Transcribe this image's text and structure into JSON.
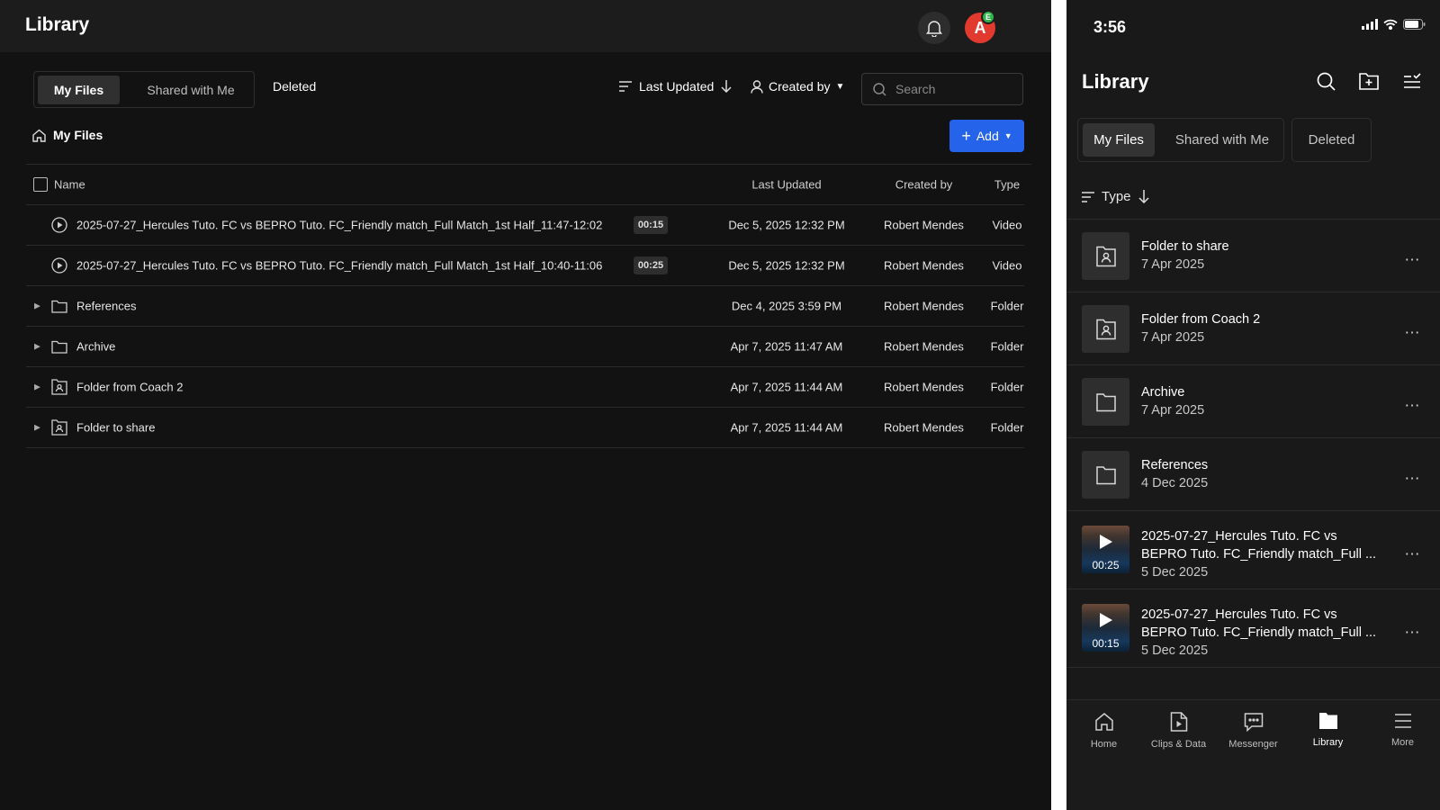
{
  "desktop": {
    "title": "Library",
    "avatar_letter": "A",
    "avatar_badge": "E",
    "tabs": [
      {
        "label": "My Files",
        "active": true
      },
      {
        "label": "Shared with Me",
        "active": false
      }
    ],
    "deleted_tab": "Deleted",
    "sort_label": "Last Updated",
    "creator_filter": "Created by",
    "search_placeholder": "Search",
    "breadcrumb": "My Files",
    "add_button": "Add",
    "columns": {
      "name": "Name",
      "last_updated": "Last Updated",
      "created_by": "Created by",
      "type": "Type"
    },
    "rows": [
      {
        "name": "2025-07-27_Hercules Tuto. FC vs BEPRO Tuto. FC_Friendly match_Full Match_1st Half_11:47-12:02",
        "duration": "00:15",
        "updated": "Dec 5, 2025 12:32 PM",
        "creator": "Robert Mendes",
        "type": "Video",
        "kind": "video"
      },
      {
        "name": "2025-07-27_Hercules Tuto. FC vs BEPRO Tuto. FC_Friendly match_Full Match_1st Half_10:40-11:06",
        "duration": "00:25",
        "updated": "Dec 5, 2025 12:32 PM",
        "creator": "Robert Mendes",
        "type": "Video",
        "kind": "video"
      },
      {
        "name": "References",
        "updated": "Dec 4, 2025 3:59 PM",
        "creator": "Robert Mendes",
        "type": "Folder",
        "kind": "folder"
      },
      {
        "name": "Archive",
        "updated": "Apr 7, 2025 11:47 AM",
        "creator": "Robert Mendes",
        "type": "Folder",
        "kind": "folder"
      },
      {
        "name": "Folder from Coach 2",
        "updated": "Apr 7, 2025 11:44 AM",
        "creator": "Robert Mendes",
        "type": "Folder",
        "kind": "shared-folder"
      },
      {
        "name": "Folder to share",
        "updated": "Apr 7, 2025 11:44 AM",
        "creator": "Robert Mendes",
        "type": "Folder",
        "kind": "shared-folder"
      }
    ]
  },
  "mobile": {
    "time": "3:56",
    "title": "Library",
    "tabs": [
      {
        "label": "My Files",
        "active": true
      },
      {
        "label": "Shared with Me",
        "active": false
      }
    ],
    "deleted_tab": "Deleted",
    "sort_label": "Type",
    "items": [
      {
        "name": "Folder to share",
        "date": "7 Apr 2025",
        "kind": "shared-folder"
      },
      {
        "name": "Folder from Coach 2",
        "date": "7 Apr 2025",
        "kind": "shared-folder"
      },
      {
        "name": "Archive",
        "date": "7 Apr 2025",
        "kind": "folder"
      },
      {
        "name": "References",
        "date": "4 Dec 2025",
        "kind": "folder"
      },
      {
        "name": "2025-07-27_Hercules Tuto. FC vs BEPRO Tuto. FC_Friendly match_Full ...",
        "date": "5 Dec 2025",
        "kind": "video",
        "duration": "00:25"
      },
      {
        "name": "2025-07-27_Hercules Tuto. FC vs BEPRO Tuto. FC_Friendly match_Full ...",
        "date": "5 Dec 2025",
        "kind": "video",
        "duration": "00:15"
      }
    ],
    "nav": [
      {
        "label": "Home",
        "icon": "home-icon",
        "active": false
      },
      {
        "label": "Clips & Data",
        "icon": "clips-icon",
        "active": false
      },
      {
        "label": "Messenger",
        "icon": "messenger-icon",
        "active": false
      },
      {
        "label": "Library",
        "icon": "library-icon",
        "active": true
      },
      {
        "label": "More",
        "icon": "menu-icon",
        "active": false
      }
    ]
  },
  "colors": {
    "accent": "#2563eb",
    "avatar": "#e23a2e",
    "badge": "#2fb34a",
    "background": "#121212"
  }
}
